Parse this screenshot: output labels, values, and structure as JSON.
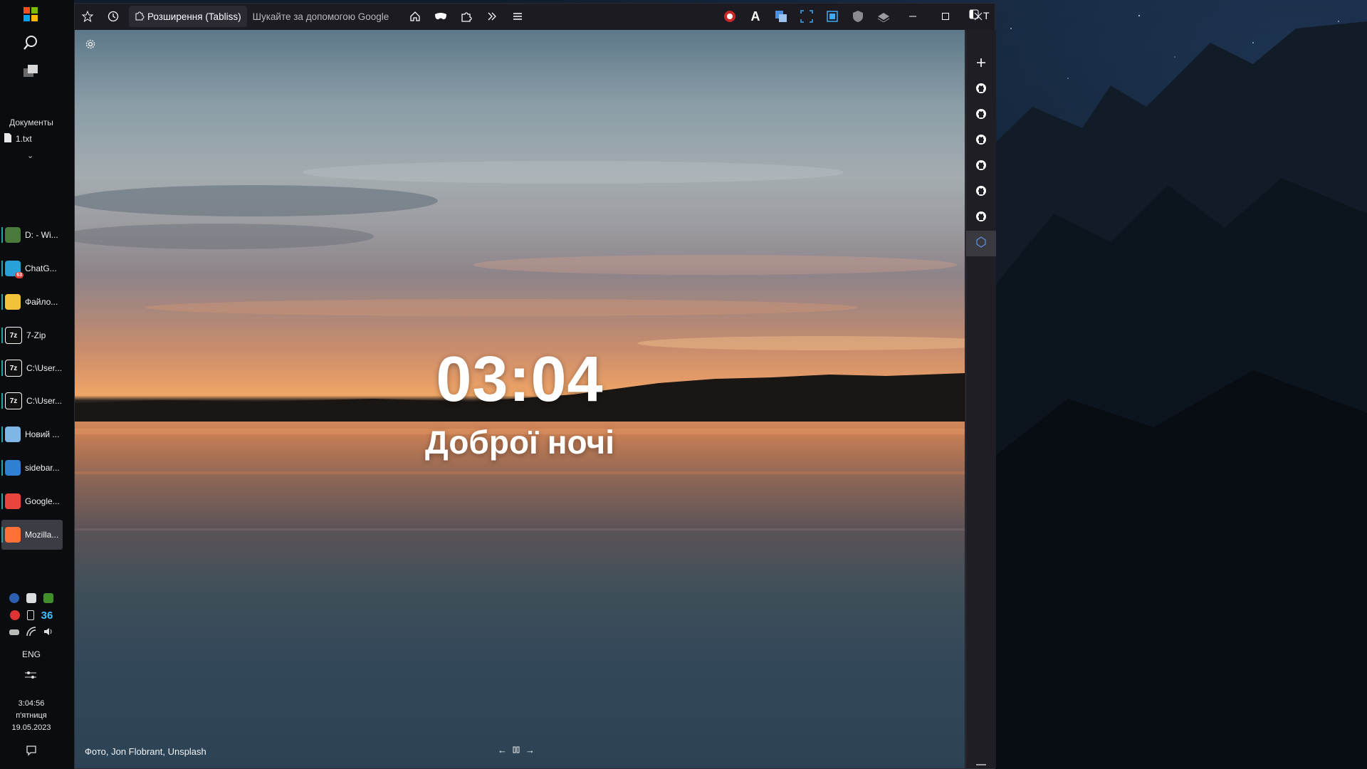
{
  "taskbar": {
    "documents_title": "Документы",
    "recent_file": "1.txt",
    "tasks": [
      {
        "label": "D: - Wi...",
        "icon": "tree-app-icon",
        "color": "#4a7a3a"
      },
      {
        "label": "ChatG...",
        "icon": "telegram-icon",
        "color": "#2aa0d8",
        "badge": "63"
      },
      {
        "label": "Файло...",
        "icon": "folder-icon",
        "color": "#f2c23b"
      },
      {
        "label": "7-Zip",
        "icon": "7zip-icon",
        "color": "#ffffff"
      },
      {
        "label": "C:\\User...",
        "icon": "7zip-icon",
        "color": "#ffffff"
      },
      {
        "label": "C:\\User...",
        "icon": "7zip-icon",
        "color": "#ffffff"
      },
      {
        "label": "Новий ...",
        "icon": "notepad-icon",
        "color": "#7fb6e6"
      },
      {
        "label": "sidebar...",
        "icon": "vscode-icon",
        "color": "#2f80d1"
      },
      {
        "label": "Google...",
        "icon": "chrome-icon",
        "color": "#e8453c"
      },
      {
        "label": "Mozilla...",
        "icon": "firefox-icon",
        "color": "#ff7139",
        "active": true
      }
    ],
    "tray_count": "36",
    "language": "ENG",
    "time": "3:04:56",
    "weekday": "п'ятниця",
    "date": "19.05.2023"
  },
  "browser": {
    "tab_title": "Розширення (Tabliss)",
    "url_placeholder": "Шукайте за допомогою Google",
    "sidebar_label": "T"
  },
  "newtab": {
    "time": "03:04",
    "greeting": "Доброї ночі",
    "photo_credit": "Фото, Jon Flobrant, Unsplash"
  },
  "sidebar": {
    "items": [
      "plus-icon",
      "github-icon",
      "github-icon",
      "github-icon",
      "github-icon",
      "github-icon",
      "github-icon",
      "extension-icon"
    ]
  }
}
